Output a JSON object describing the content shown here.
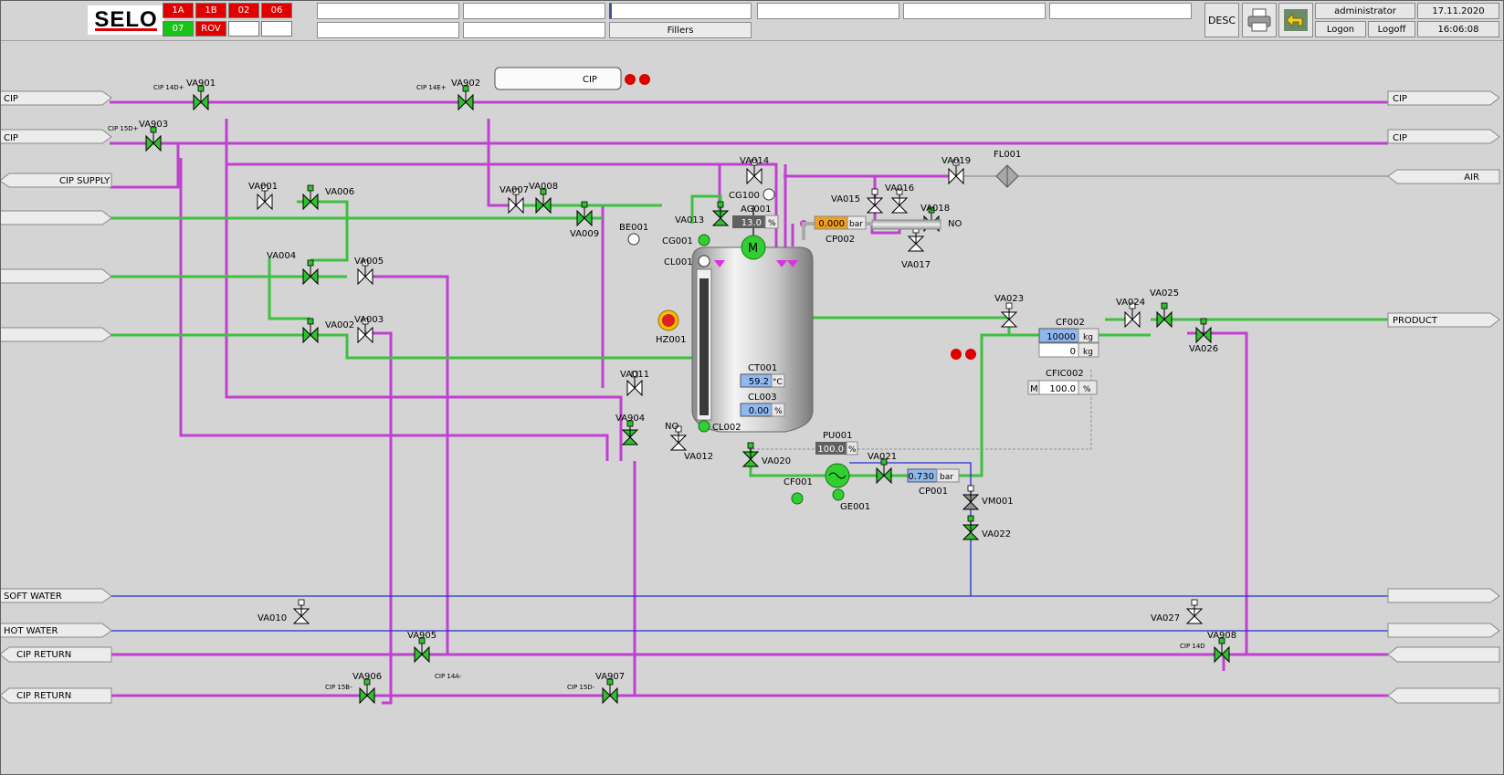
{
  "header": {
    "logo": "SELO",
    "alarms": [
      {
        "label": "1A",
        "state": "red"
      },
      {
        "label": "1B",
        "state": "red"
      },
      {
        "label": "02",
        "state": "red"
      },
      {
        "label": "06",
        "state": "red"
      },
      {
        "label": "07",
        "state": "green"
      },
      {
        "label": "ROV",
        "state": "red"
      },
      {
        "label": "",
        "state": "white"
      },
      {
        "label": "",
        "state": "white"
      }
    ],
    "fillers_label": "Fillers",
    "desc_label": "DESC",
    "print_icon": "printer-icon",
    "back_icon": "back-arrow-icon",
    "user": "administrator",
    "logon_label": "Logon",
    "logoff_label": "Logoff",
    "date": "17.11.2020",
    "time": "16:06:08"
  },
  "colors": {
    "cip": "#c040d0",
    "product": "#40c040",
    "water": "#2030d0",
    "air": "#909090",
    "valve_on": "#30c030"
  },
  "arrows": {
    "left": [
      "CIP",
      "CIP",
      "CIP SUPPLY",
      "",
      "",
      "",
      "SOFT WATER",
      "HOT WATER",
      "CIP RETURN",
      "CIP RETURN"
    ],
    "right": [
      "CIP",
      "CIP",
      "AIR",
      "PRODUCT",
      "",
      "",
      "",
      ""
    ]
  },
  "cip_box": {
    "label": "CIP"
  },
  "valves": {
    "VA901": "VA901",
    "VA902": "VA902",
    "VA903": "VA903",
    "VA904": "VA904",
    "VA905": "VA905",
    "VA906": "VA906",
    "VA907": "VA907",
    "VA908": "VA908",
    "VA001": "VA001",
    "VA002": "VA002",
    "VA003": "VA003",
    "VA004": "VA004",
    "VA005": "VA005",
    "VA006": "VA006",
    "VA007": "VA007",
    "VA008": "VA008",
    "VA009": "VA009",
    "VA010": "VA010",
    "VA011": "VA011",
    "VA012": "VA012",
    "VA013": "VA013",
    "VA014": "VA014",
    "VA015": "VA015",
    "VA016": "VA016",
    "VA017": "VA017",
    "VA018": "VA018",
    "VA019": "VA019",
    "VA020": "VA020",
    "VA021": "VA021",
    "VA022": "VA022",
    "VA023": "VA023",
    "VA024": "VA024",
    "VA025": "VA025",
    "VA026": "VA026",
    "VA027": "VA027",
    "VM001": "VM001"
  },
  "cip_tags": {
    "t14d_plus": "CIP 14D+",
    "t14e_plus": "CIP 14E+",
    "t15d_plus": "CIP 15D+",
    "t14a_minus": "CIP 14A-",
    "t15b_minus": "CIP 15B-",
    "t15d_minus": "CIP 15D-",
    "t14d": "CIP 14D"
  },
  "instruments": {
    "FL001": "FL001",
    "BE001": "BE001",
    "CG100": "CG100",
    "CG001": "CG001",
    "CL001": "CL001",
    "CL002": "CL002",
    "HZ001": "HZ001",
    "AG001": {
      "tag": "AG001",
      "value": "13.0",
      "unit": "%"
    },
    "CP002": {
      "tag": "CP002",
      "value": "0.000",
      "unit": "bar"
    },
    "CT001": {
      "tag": "CT001",
      "value": "59.2",
      "unit": "°C"
    },
    "CL003": {
      "tag": "CL003",
      "value": "0.00",
      "unit": "%"
    },
    "PU001": {
      "tag": "PU001",
      "value": "100.0",
      "unit": "%"
    },
    "CP001": {
      "tag": "CP001",
      "value": "0.730",
      "unit": "bar"
    },
    "CF002": {
      "tag": "CF002",
      "value": "10000",
      "unit": "kg",
      "value2": "0",
      "unit2": "kg"
    },
    "CFIC002": {
      "tag": "CFIC002",
      "mode": "M",
      "value": "100.0",
      "unit": "%"
    },
    "CF001": "CF001",
    "GE001": "GE001",
    "motor": "M",
    "no_18": "NO",
    "no_12": "NO"
  }
}
